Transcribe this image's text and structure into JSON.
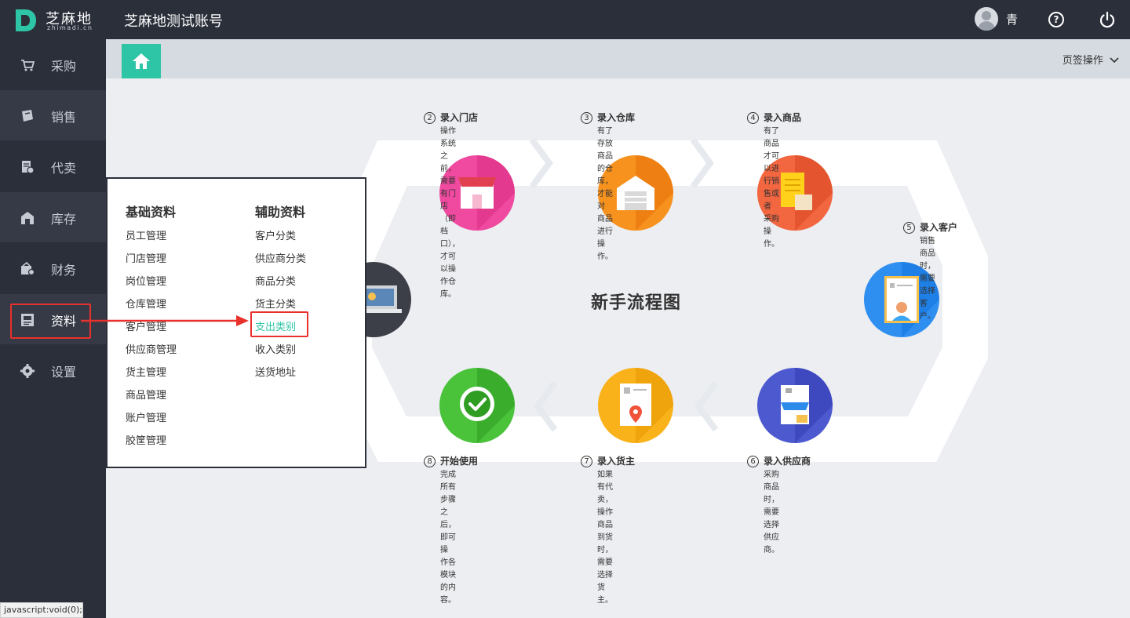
{
  "brand": {
    "logo_cn": "芝麻地",
    "logo_en": "zhimadi.cn",
    "account_title": "芝麻地测试账号"
  },
  "user": {
    "name": "青"
  },
  "sidebar": {
    "items": [
      {
        "label": "采购",
        "icon": "cart-icon"
      },
      {
        "label": "销售",
        "icon": "sale-icon"
      },
      {
        "label": "代卖",
        "icon": "consign-icon"
      },
      {
        "label": "库存",
        "icon": "warehouse-icon"
      },
      {
        "label": "财务",
        "icon": "finance-icon"
      },
      {
        "label": "资料",
        "icon": "data-icon"
      },
      {
        "label": "设置",
        "icon": "gear-icon"
      }
    ]
  },
  "tabbar": {
    "tab_ops_label": "页签操作"
  },
  "flow": {
    "title": "新手流程图",
    "steps": [
      {
        "num": "2",
        "title": "录入门店",
        "desc": [
          "操作系统之前，需要有门店（即",
          "档口），才可以操作仓库。"
        ]
      },
      {
        "num": "3",
        "title": "录入仓库",
        "desc": [
          "有了存放商品的仓库，才能对",
          "商品进行操作。"
        ]
      },
      {
        "num": "4",
        "title": "录入商品",
        "desc": [
          "有了商品才可以进行销售或者",
          "采购操作。"
        ]
      },
      {
        "num": "5",
        "title": "录入客户",
        "desc": [
          "销售商品时，需要选择客户。"
        ]
      },
      {
        "num": "6",
        "title": "录入供应商",
        "desc": [
          "采购商品时，需要选择供应商。"
        ]
      },
      {
        "num": "7",
        "title": "录入货主",
        "desc": [
          "如果有代卖，操作商品到货",
          "时，需要选择货主。"
        ]
      },
      {
        "num": "8",
        "title": "开始使用",
        "desc": [
          "完成所有步骤之后，即可操",
          "作各模块的内容。"
        ]
      }
    ]
  },
  "menu": {
    "basic_title": "基础资料",
    "basic_items": [
      "员工管理",
      "门店管理",
      "岗位管理",
      "仓库管理",
      "客户管理",
      "供应商管理",
      "货主管理",
      "商品管理",
      "账户管理",
      "胶筐管理"
    ],
    "aux_title": "辅助资料",
    "aux_items": [
      "客户分类",
      "供应商分类",
      "商品分类",
      "货主分类",
      "支出类别",
      "收入类别",
      "送货地址"
    ]
  },
  "statusbar": {
    "text": "javascript:void(0);"
  },
  "colors": {
    "accent": "#2ec4a6",
    "sidebar": "#2b2f3a",
    "highlight": "#e8312c"
  }
}
